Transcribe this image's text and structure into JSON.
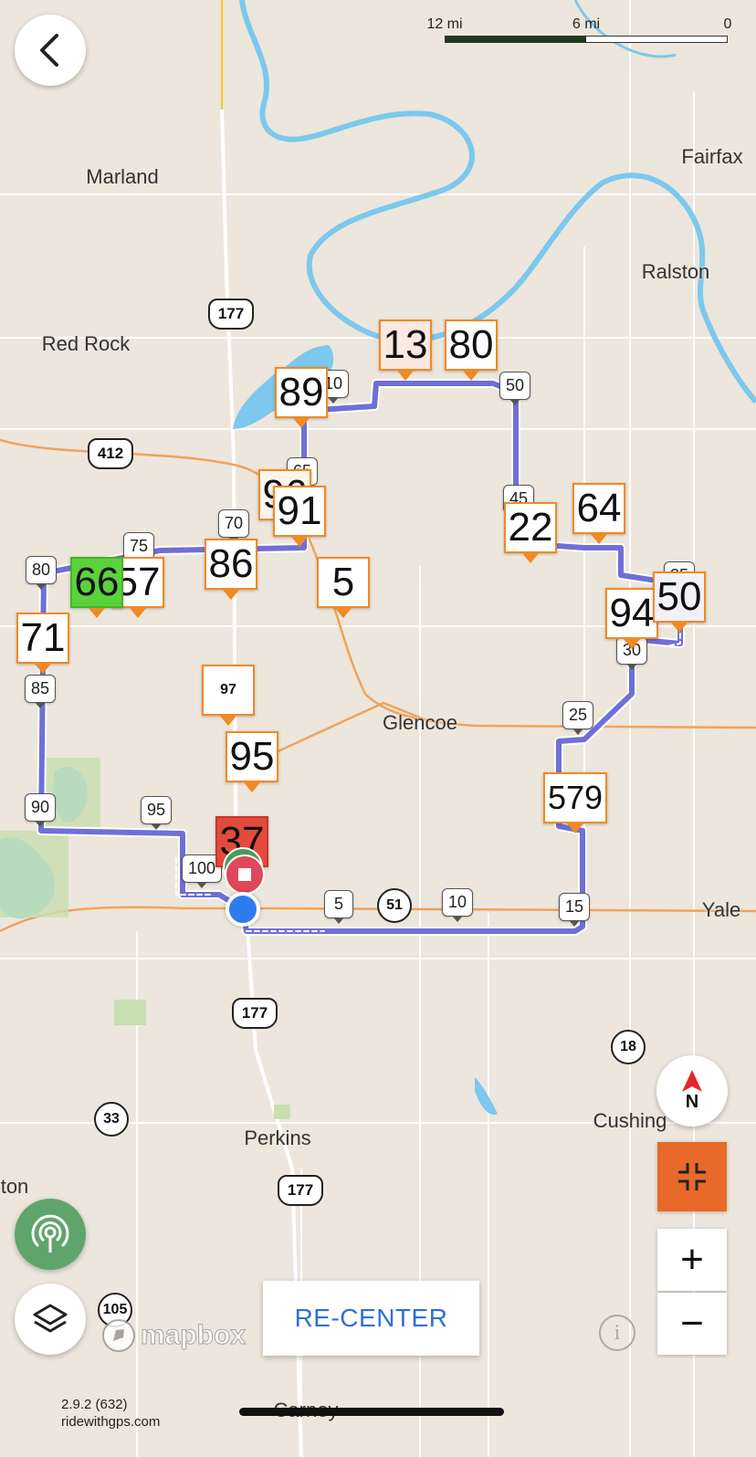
{
  "scale": {
    "left_label": "12 mi",
    "mid_label": "6 mi",
    "right_label": "0"
  },
  "places": {
    "marland": "Marland",
    "fairfax": "Fairfax",
    "ralston": "Ralston",
    "red_rock": "Red Rock",
    "glencoe": "Glencoe",
    "yale": "Yale",
    "cushing": "Cushing",
    "perkins": "Perkins",
    "carney": "Carney",
    "ton": "ton"
  },
  "highways": {
    "us177_top": "177",
    "us412": "412",
    "sh51": "51",
    "us177_mid": "177",
    "sh18": "18",
    "sh33": "33",
    "us177_bottom": "177",
    "sh105": "105"
  },
  "mile_markers": {
    "m10_top": "10",
    "m50_top": "50",
    "m45": "45",
    "m65": "65",
    "m70": "70",
    "m75": "75",
    "m80": "80",
    "m85": "85",
    "m90": "90",
    "m95": "95",
    "m100": "100",
    "m5": "5",
    "m10": "10",
    "m15": "15",
    "m25": "25",
    "m30": "30",
    "m35": "35"
  },
  "pois": {
    "p13": "13",
    "p80": "80",
    "p89": "89",
    "p91": "91",
    "p96": "96",
    "p86": "86",
    "p5": "5",
    "p66": "66",
    "p57": "57",
    "p71": "71",
    "p97": "97",
    "p95": "95",
    "p22": "22",
    "p64": "64",
    "p94": "94",
    "p50": "50",
    "p579": "579",
    "p37": "37"
  },
  "buttons": {
    "recenter_label": "RE-CENTER",
    "zoom_in": "+",
    "zoom_out": "−",
    "compass_label": "N",
    "info": "i"
  },
  "footer": {
    "version": "2.9.2 (632)",
    "site": "ridewithgps.com",
    "brand": "mapbox"
  },
  "colors": {
    "route": "#6f6fd6",
    "poi_border": "#f08a24",
    "fullscreen_bg": "#e8692a",
    "live_btn": "#5fa56b",
    "recenter_text": "#2f6fd6",
    "river": "#7cc8ee",
    "road": "#f0a35a"
  }
}
